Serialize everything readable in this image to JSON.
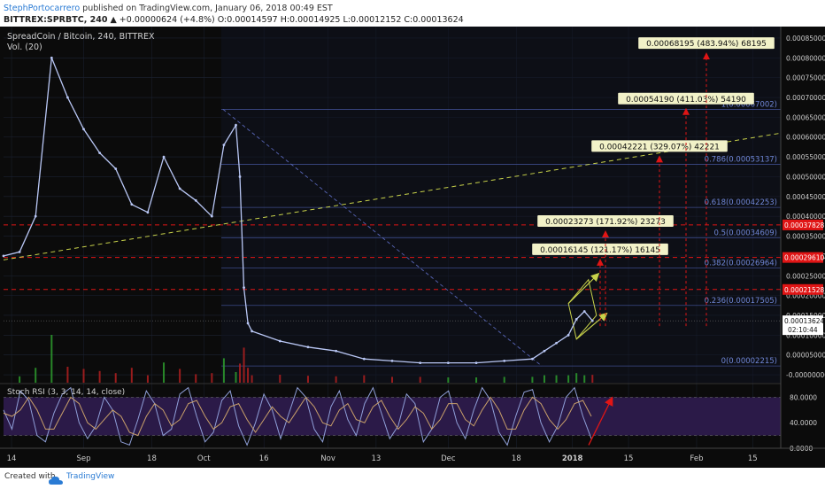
{
  "header": {
    "author": "StephPortocarrero",
    "published": "published on TradingView.com, January 06, 2018 00:49 EST",
    "symbol": "BITTREX:SPRBTC, 240",
    "change": "▲ +0.00000624 (+4.8%)",
    "ohlc": "O:0.00014597 H:0.00014925 L:0.00012152 C:0.00013624"
  },
  "footer": {
    "created_with": "Created with",
    "brand": "TradingView"
  },
  "colors": {
    "background": "#0b0b0b",
    "grid": "#1c2333",
    "price_line": "#b9c7f5",
    "trendline": "#c8d24a",
    "fib": "#3d4b8a",
    "fib_text": "#6f86d6",
    "resistance": "#e01515",
    "stoch_fill": "#2b1a48",
    "stoch_k": "#8f9fd8",
    "stoch_d": "#c9a06a",
    "target_bg": "#f2f2c8"
  },
  "chart_data": [
    {
      "type": "line",
      "title": "SpreadCoin / Bitcoin, 240, BITTREX",
      "subtitle": "Vol. (20)",
      "x_axis_ticks": [
        "14",
        "Sep",
        "18",
        "Oct",
        "16",
        "Nov",
        "13",
        "Dec",
        "18",
        "2018",
        "15",
        "Feb",
        "15"
      ],
      "y_axis_ticks": [
        "0.00085000",
        "0.00080000",
        "0.00075000",
        "0.00070000",
        "0.00065000",
        "0.00060000",
        "0.00055000",
        "0.00050000",
        "0.00045000",
        "0.00040000",
        "0.00035000",
        "0.00030000",
        "0.00025000",
        "0.00020000",
        "0.00015000",
        "0.00010000",
        "0.00005000",
        "-0.00000000"
      ],
      "ylim": [
        0,
        0.00088
      ],
      "grid": true,
      "series": [
        {
          "name": "SPRBTC",
          "x": [
            "2017-08-12",
            "2017-08-16",
            "2017-08-20",
            "2017-08-24",
            "2017-08-28",
            "2017-09-01",
            "2017-09-05",
            "2017-09-09",
            "2017-09-13",
            "2017-09-17",
            "2017-09-21",
            "2017-09-25",
            "2017-09-29",
            "2017-10-03",
            "2017-10-06",
            "2017-10-09",
            "2017-10-10",
            "2017-10-11",
            "2017-10-12",
            "2017-10-13",
            "2017-10-20",
            "2017-10-27",
            "2017-11-03",
            "2017-11-10",
            "2017-11-17",
            "2017-11-24",
            "2017-12-01",
            "2017-12-08",
            "2017-12-15",
            "2017-12-22",
            "2017-12-25",
            "2017-12-28",
            "2017-12-31",
            "2018-01-02",
            "2018-01-04",
            "2018-01-06"
          ],
          "values": [
            0.0003,
            0.00031,
            0.0004,
            0.0008,
            0.0007,
            0.00062,
            0.00056,
            0.00052,
            0.00043,
            0.00041,
            0.00055,
            0.00047,
            0.00044,
            0.0004,
            0.00058,
            0.00063,
            0.0005,
            0.00022,
            0.00013,
            0.00011,
            8.5e-05,
            7e-05,
            6e-05,
            4e-05,
            3.5e-05,
            3e-05,
            3e-05,
            3e-05,
            3.5e-05,
            4e-05,
            6e-05,
            8e-05,
            0.0001,
            0.00014,
            0.00016,
            0.00013624
          ]
        }
      ],
      "last_price": "0.00013624",
      "countdown": "02:10:44",
      "resistance_levels": [
        {
          "value": 0.00037828,
          "label": "0.00037828"
        },
        {
          "value": 0.0002961,
          "label": "0.00029610"
        },
        {
          "value": 0.00021528,
          "label": "0.00021528"
        }
      ],
      "fib_levels": [
        {
          "ratio": "1",
          "value": 0.00067002,
          "label": "1(0.00067002)"
        },
        {
          "ratio": "0.786",
          "value": 0.00053137,
          "label": "0.786(0.00053137)"
        },
        {
          "ratio": "0.618",
          "value": 0.00042253,
          "label": "0.618(0.00042253)"
        },
        {
          "ratio": "0.5",
          "value": 0.00034609,
          "label": "0.5(0.00034609)"
        },
        {
          "ratio": "0.382",
          "value": 0.00026964,
          "label": "0.382(0.00026964)"
        },
        {
          "ratio": "0.236",
          "value": 0.00017505,
          "label": "0.236(0.00017505)"
        },
        {
          "ratio": "0",
          "value": 2.215e-05,
          "label": "0(0.00002215)"
        }
      ],
      "targets": [
        {
          "label": "0.00016145 (121.17%) 16145",
          "value": 0.00029769
        },
        {
          "label": "0.00023273 (171.92%) 23273",
          "value": 0.00036897
        },
        {
          "label": "0.00042221 (329.07%) 42221",
          "value": 0.00055845
        },
        {
          "label": "0.00054190 (411.03%) 54190",
          "value": 0.00067814
        },
        {
          "label": "0.00068195 (483.94%) 68195",
          "value": 0.00081819
        }
      ]
    },
    {
      "type": "line",
      "title": "Stoch RSI (3, 3, 14, 14, close)",
      "y_axis_ticks": [
        "80.0000",
        "40.0000",
        "0.0000"
      ],
      "ylim": [
        0,
        100
      ],
      "bands": [
        80,
        20
      ],
      "series": [
        {
          "name": "K",
          "values": [
            60,
            30,
            90,
            75,
            20,
            10,
            55,
            85,
            95,
            40,
            15,
            35,
            80,
            60,
            10,
            5,
            45,
            90,
            70,
            20,
            30,
            85,
            95,
            50,
            10,
            25,
            75,
            90,
            35,
            5,
            40,
            85,
            60,
            15,
            55,
            95,
            80,
            30,
            10,
            65,
            90,
            45,
            20,
            70,
            95,
            55,
            15,
            35,
            85,
            70,
            10,
            30,
            80,
            90,
            40,
            15,
            60,
            95,
            75,
            25,
            5,
            50,
            88,
            92,
            40,
            10,
            35,
            80,
            95,
            50,
            15
          ]
        },
        {
          "name": "D",
          "values": [
            55,
            50,
            60,
            80,
            60,
            30,
            30,
            55,
            80,
            70,
            40,
            30,
            45,
            60,
            50,
            25,
            20,
            50,
            70,
            60,
            35,
            45,
            70,
            75,
            50,
            30,
            40,
            65,
            70,
            45,
            25,
            45,
            65,
            50,
            40,
            60,
            80,
            65,
            40,
            35,
            60,
            70,
            45,
            40,
            65,
            75,
            50,
            30,
            45,
            65,
            55,
            30,
            45,
            70,
            70,
            45,
            35,
            60,
            80,
            60,
            30,
            30,
            60,
            80,
            70,
            45,
            30,
            45,
            70,
            75,
            50
          ]
        }
      ]
    }
  ]
}
